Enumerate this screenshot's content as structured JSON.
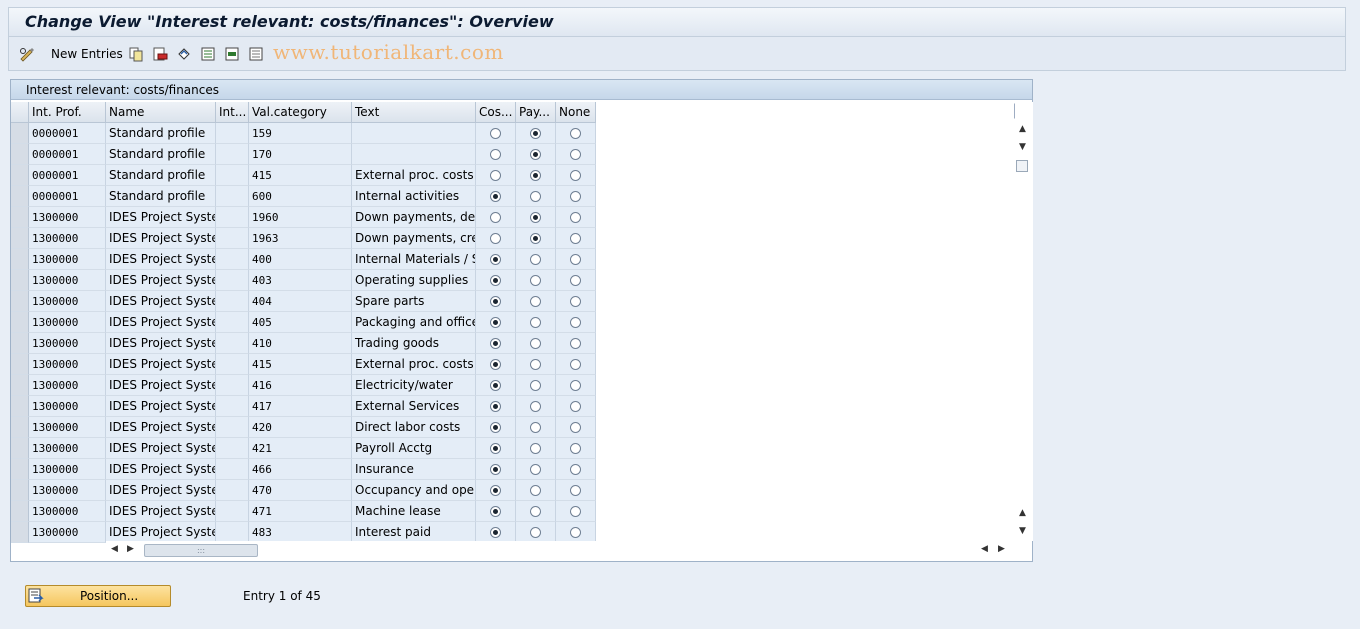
{
  "window": {
    "title": "Change View \"Interest relevant: costs/finances\": Overview"
  },
  "toolbar": {
    "new_entries_label": "New Entries",
    "watermark": "www.tutorialkart.com",
    "icons": [
      "glasses-edit-icon",
      "copy-icon",
      "delete-icon",
      "undo-icon",
      "select-all-icon",
      "select-block-icon",
      "deselect-all-icon"
    ]
  },
  "table": {
    "title": "Interest relevant: costs/finances",
    "columns": [
      "Int. Prof.",
      "Name",
      "Int...",
      "Val.category",
      "Text",
      "Cos...",
      "Pay...",
      "None"
    ],
    "rows": [
      {
        "prof": "0000001",
        "name": "Standard profile",
        "int": "",
        "val": "159",
        "text": "",
        "choice": "pay"
      },
      {
        "prof": "0000001",
        "name": "Standard profile",
        "int": "",
        "val": "170",
        "text": "",
        "choice": "pay"
      },
      {
        "prof": "0000001",
        "name": "Standard profile",
        "int": "",
        "val": "415",
        "text": "External proc. costs",
        "choice": "pay"
      },
      {
        "prof": "0000001",
        "name": "Standard profile",
        "int": "",
        "val": "600",
        "text": "Internal activities",
        "choice": "cost"
      },
      {
        "prof": "1300000",
        "name": "IDES Project Syste...",
        "int": "",
        "val": "1960",
        "text": "Down payments, de...",
        "choice": "pay"
      },
      {
        "prof": "1300000",
        "name": "IDES Project Syste...",
        "int": "",
        "val": "1963",
        "text": "Down payments, cre...",
        "choice": "pay"
      },
      {
        "prof": "1300000",
        "name": "IDES Project Syste...",
        "int": "",
        "val": "400",
        "text": "Internal Materials / S...",
        "choice": "cost"
      },
      {
        "prof": "1300000",
        "name": "IDES Project Syste...",
        "int": "",
        "val": "403",
        "text": "Operating supplies",
        "choice": "cost"
      },
      {
        "prof": "1300000",
        "name": "IDES Project Syste...",
        "int": "",
        "val": "404",
        "text": "Spare parts",
        "choice": "cost"
      },
      {
        "prof": "1300000",
        "name": "IDES Project Syste...",
        "int": "",
        "val": "405",
        "text": "Packaging and office ...",
        "choice": "cost"
      },
      {
        "prof": "1300000",
        "name": "IDES Project Syste...",
        "int": "",
        "val": "410",
        "text": "Trading goods",
        "choice": "cost"
      },
      {
        "prof": "1300000",
        "name": "IDES Project Syste...",
        "int": "",
        "val": "415",
        "text": "External proc. costs",
        "choice": "cost"
      },
      {
        "prof": "1300000",
        "name": "IDES Project Syste...",
        "int": "",
        "val": "416",
        "text": "Electricity/water",
        "choice": "cost"
      },
      {
        "prof": "1300000",
        "name": "IDES Project Syste...",
        "int": "",
        "val": "417",
        "text": "External Services",
        "choice": "cost"
      },
      {
        "prof": "1300000",
        "name": "IDES Project Syste...",
        "int": "",
        "val": "420",
        "text": "Direct labor costs",
        "choice": "cost"
      },
      {
        "prof": "1300000",
        "name": "IDES Project Syste...",
        "int": "",
        "val": "421",
        "text": "Payroll Acctg",
        "choice": "cost"
      },
      {
        "prof": "1300000",
        "name": "IDES Project Syste...",
        "int": "",
        "val": "466",
        "text": "Insurance",
        "choice": "cost"
      },
      {
        "prof": "1300000",
        "name": "IDES Project Syste...",
        "int": "",
        "val": "470",
        "text": "Occupancy and oper...",
        "choice": "cost"
      },
      {
        "prof": "1300000",
        "name": "IDES Project Syste...",
        "int": "",
        "val": "471",
        "text": "Machine lease",
        "choice": "cost"
      },
      {
        "prof": "1300000",
        "name": "IDES Project Syste...",
        "int": "",
        "val": "483",
        "text": "Interest paid",
        "choice": "cost"
      }
    ]
  },
  "footer": {
    "position_label": "Position...",
    "entry_text": "Entry 1 of 45"
  },
  "colors": {
    "background": "#e8eef6",
    "row_background": "#e4edf7",
    "button_yellow": "#f5c65e",
    "watermark": "#f0b678"
  }
}
